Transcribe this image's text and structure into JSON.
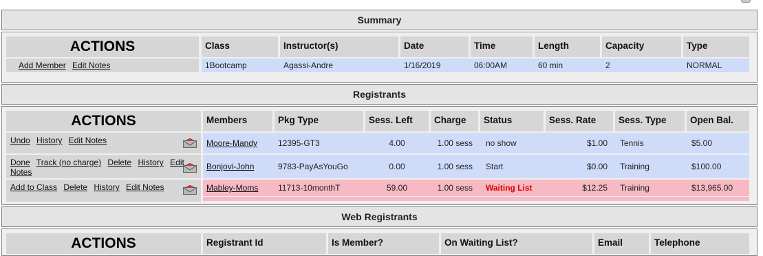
{
  "summary": {
    "title": "Summary",
    "actions_heading": "ACTIONS",
    "columns": [
      "Class",
      "Instructor(s)",
      "Date",
      "Time",
      "Length",
      "Capacity",
      "Type"
    ],
    "actions": [
      "Add Member",
      "Edit Notes"
    ],
    "row": [
      "1Bootcamp",
      "Agassi-Andre",
      "1/16/2019",
      "06:00AM",
      "60 min",
      "2",
      "NORMAL"
    ]
  },
  "registrants": {
    "title": "Registrants",
    "actions_heading": "ACTIONS",
    "columns": [
      "Members",
      "Pkg Type",
      "Sess. Left",
      "Charge",
      "Status",
      "Sess. Rate",
      "Sess. Type",
      "Open Bal."
    ],
    "rows": [
      {
        "actions": [
          "Undo",
          "History",
          "Edit Notes"
        ],
        "member": "Moore-Mandy",
        "pkg": "12395-GT3",
        "left": "4.00",
        "charge": "1.00 sess",
        "status": "no show",
        "rate": "$1.00",
        "stype": "Tennis",
        "bal": "$5.00"
      },
      {
        "actions": [
          "Done",
          "Track (no charge)",
          "Delete",
          "History",
          "Edit",
          "Notes"
        ],
        "member": "Bonjovi-John",
        "pkg": "9783-PayAsYouGo",
        "left": "0.00",
        "charge": "1.00 sess",
        "status": "Start",
        "rate": "$0.00",
        "stype": "Training",
        "bal": "$100.00"
      },
      {
        "actions": [
          "Add to Class",
          "Delete",
          "History",
          "Edit Notes"
        ],
        "member": "Mabley-Moms",
        "pkg": "11713-10monthT",
        "left": "59.00",
        "charge": "1.00 sess",
        "status": "Waiting List",
        "rate": "$12.25",
        "stype": "Training",
        "bal": "$13,965.00"
      }
    ]
  },
  "web_registrants": {
    "title": "Web Registrants",
    "actions_heading": "ACTIONS",
    "columns": [
      "Registrant Id",
      "Is Member?",
      "On Waiting List?",
      "Email",
      "Telephone"
    ]
  },
  "colors": {
    "row_blue": "#cfdcf9",
    "row_pink": "#f7b9c4",
    "header_gray": "#d6d6d6",
    "waiting_red": "#d90000"
  },
  "icons": [
    "envelope-icon"
  ]
}
